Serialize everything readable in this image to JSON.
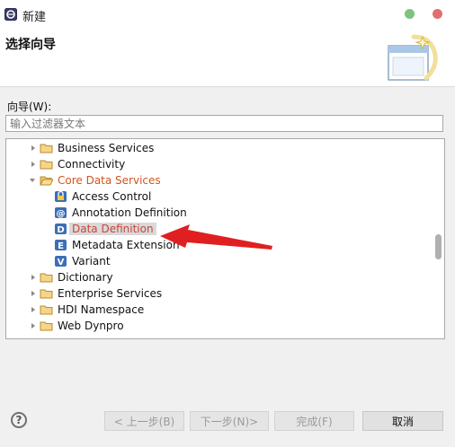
{
  "window": {
    "title": "新建",
    "app_icon": "eclipse-icon",
    "controls": {
      "minimize_color": "#7ec27e",
      "close_color": "#e0706e"
    }
  },
  "header": {
    "page_title": "选择向导",
    "icon": "new-wizard-icon"
  },
  "filter": {
    "label": "向导(W):",
    "placeholder": "输入过滤器文本",
    "value": ""
  },
  "tree": {
    "items": [
      {
        "label": "Business Services",
        "level": 1,
        "expanded": false,
        "icon": "folder-icon"
      },
      {
        "label": "Connectivity",
        "level": 1,
        "expanded": false,
        "icon": "folder-icon"
      },
      {
        "label": "Core Data Services",
        "level": 1,
        "expanded": true,
        "icon": "folder-open-icon",
        "highlight": true
      },
      {
        "label": "Access Control",
        "level": 2,
        "icon": "access-control-icon"
      },
      {
        "label": "Annotation Definition",
        "level": 2,
        "icon": "annotation-icon"
      },
      {
        "label": "Data Definition",
        "level": 2,
        "icon": "data-definition-icon",
        "selected": true
      },
      {
        "label": "Metadata Extension",
        "level": 2,
        "icon": "metadata-extension-icon"
      },
      {
        "label": "Variant",
        "level": 2,
        "icon": "variant-icon"
      },
      {
        "label": "Dictionary",
        "level": 1,
        "expanded": false,
        "icon": "folder-icon"
      },
      {
        "label": "Enterprise Services",
        "level": 1,
        "expanded": false,
        "icon": "folder-icon"
      },
      {
        "label": "HDI Namespace",
        "level": 1,
        "expanded": false,
        "icon": "folder-icon"
      },
      {
        "label": "Web Dynpro",
        "level": 1,
        "expanded": false,
        "icon": "folder-icon"
      }
    ],
    "annotation": {
      "type": "arrow",
      "color": "#e02020",
      "points_to": "Data Definition"
    }
  },
  "footer": {
    "help_icon": "?",
    "back": "< 上一步(B)",
    "next": "下一步(N)>",
    "finish": "完成(F)",
    "cancel": "取消"
  },
  "colors": {
    "accent": "#d2541e",
    "selection_bg": "#d9d9d9",
    "arrow": "#e02020"
  }
}
